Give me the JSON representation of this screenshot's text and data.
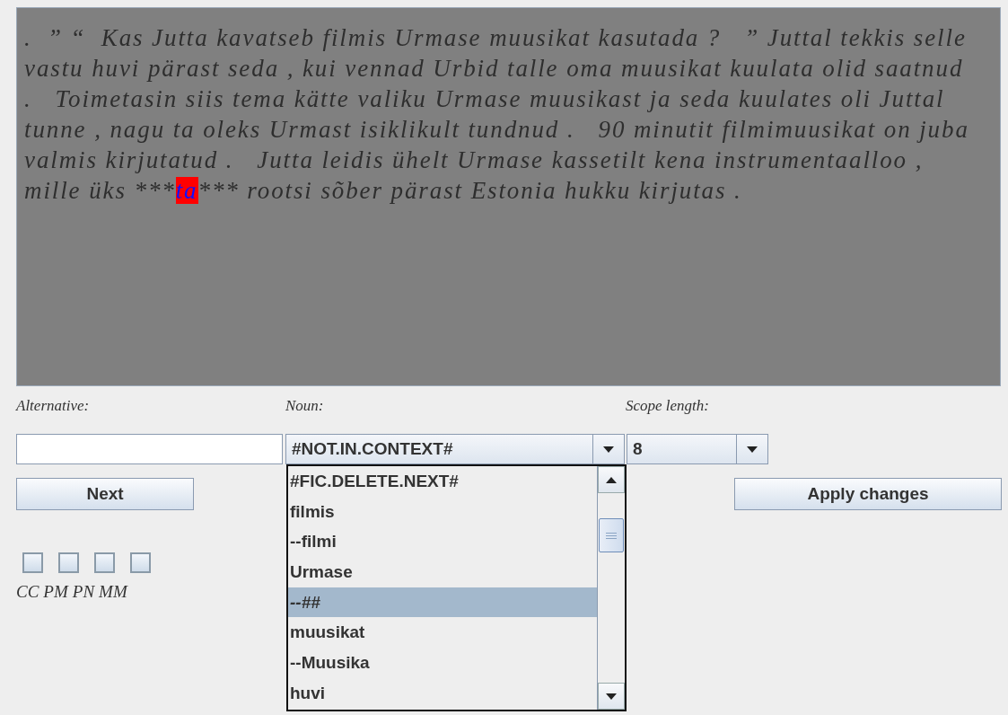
{
  "text_area": {
    "lines": [
      {
        "text": ".  ” “  Kas Jutta kavatseb filmis Urmase muusikat kasutada ?   ” Juttal tekkis selle"
      },
      {
        "text": "vastu huvi pärast seda , kui vennad Urbid talle oma muusikat kuulata olid saatnud"
      },
      {
        "text": ".   Toimetasin siis tema kätte valiku Urmase muusikast ja seda kuulates oli Juttal"
      },
      {
        "text": "tunne , nagu ta oleks Urmast isiklikult tundnud .   90 minutit filmimuusikat on juba"
      },
      {
        "text": "valmis kirjutatud .   Jutta leidis ühelt Urmase kassetilt kena instrumentaalloo ,"
      },
      {
        "text": "mille üks ***",
        "highlight": "ta",
        "after": "*** rootsi sõber pärast Estonia hukku kirjutas ."
      }
    ]
  },
  "alternative": {
    "label": "Alternative:"
  },
  "noun": {
    "label": "Noun:",
    "value": "#NOT.IN.CONTEXT#",
    "expanded": true,
    "options": [
      {
        "label": "#FIC.DELETE.NEXT#",
        "selected": false
      },
      {
        "label": "filmis",
        "selected": false
      },
      {
        "label": "--filmi",
        "selected": false
      },
      {
        "label": "Urmase",
        "selected": false
      },
      {
        "label": "--##",
        "selected": true
      },
      {
        "label": "muusikat",
        "selected": false
      },
      {
        "label": "--Muusika",
        "selected": false
      },
      {
        "label": "huvi",
        "selected": false
      }
    ]
  },
  "scope_length": {
    "label": "Scope length:",
    "value": "8"
  },
  "buttons": {
    "next": "Next",
    "apply": "Apply changes"
  },
  "checkboxes": [
    {
      "label": "CC",
      "checked": false
    },
    {
      "label": "PM",
      "checked": false
    },
    {
      "label": "PN",
      "checked": false
    },
    {
      "label": "MM",
      "checked": false
    }
  ]
}
